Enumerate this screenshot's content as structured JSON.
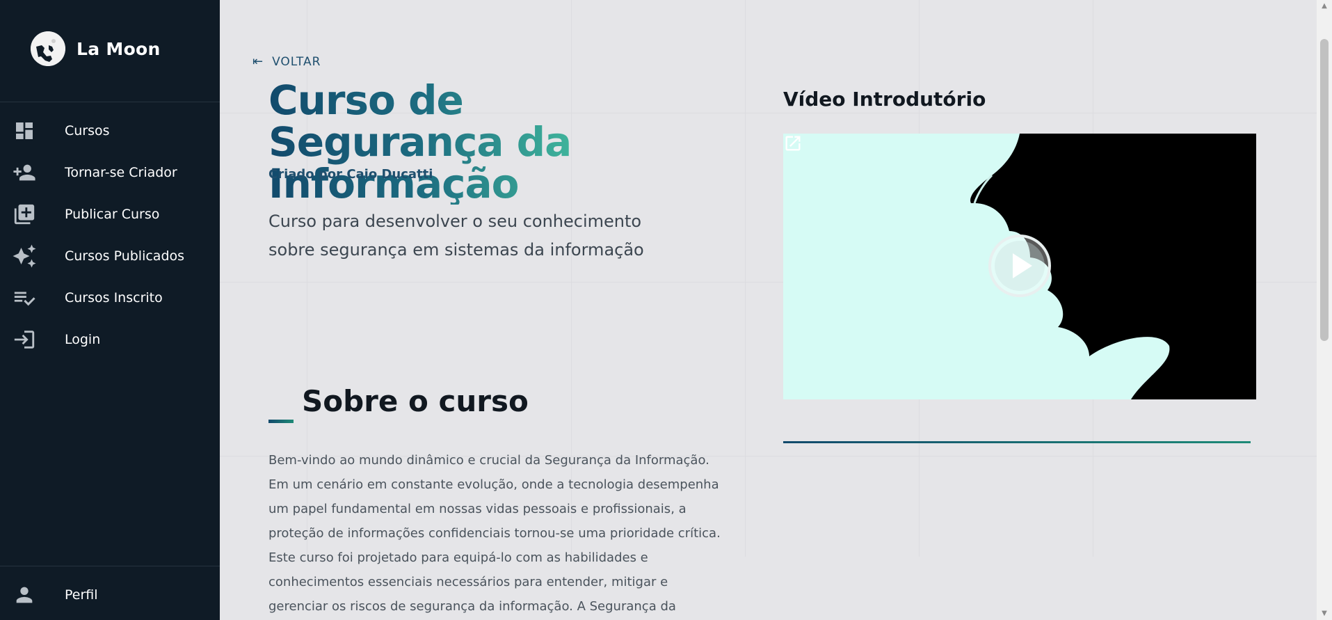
{
  "brand": {
    "name": "La Moon",
    "logo_icon": "moon-logo-icon"
  },
  "sidebar": {
    "items": [
      {
        "label": "Cursos",
        "icon": "dashboard-icon"
      },
      {
        "label": "Tornar-se Criador",
        "icon": "person-add-icon"
      },
      {
        "label": "Publicar Curso",
        "icon": "library-add-icon"
      },
      {
        "label": "Cursos Publicados",
        "icon": "sparkles-icon"
      },
      {
        "label": "Cursos Inscrito",
        "icon": "playlist-check-icon"
      },
      {
        "label": "Login",
        "icon": "login-icon"
      }
    ],
    "profile": {
      "label": "Perfil",
      "icon": "person-icon"
    }
  },
  "main": {
    "back_label": "VOLTAR",
    "title": "Curso de Segurança da Informação",
    "creator": "Criado por Caio Ducatti",
    "description": "Curso para desenvolver o seu conhecimento sobre segurança em sistemas da informação",
    "about": {
      "title": "Sobre o curso",
      "text": "Bem-vindo ao mundo dinâmico e crucial da Segurança da Informação. Em um cenário em constante evolução, onde a tecnologia desempenha um papel fundamental em nossas vidas pessoais e profissionais, a proteção de informações confidenciais tornou-se uma prioridade crítica. Este curso foi projetado para equipá-lo com as habilidades e conhecimentos essenciais necessários para entender, mitigar e gerenciar os riscos de segurança da informação. A Segurança da Informação"
    },
    "video": {
      "title": "Vídeo Introdutório",
      "open_icon": "open-in-new-icon",
      "play_icon": "play-icon"
    }
  },
  "colors": {
    "sidebar_bg": "#0f1b26",
    "page_bg": "#e5e5e8",
    "accent_dark": "#124a6c",
    "accent_light": "#6ce0b4"
  }
}
